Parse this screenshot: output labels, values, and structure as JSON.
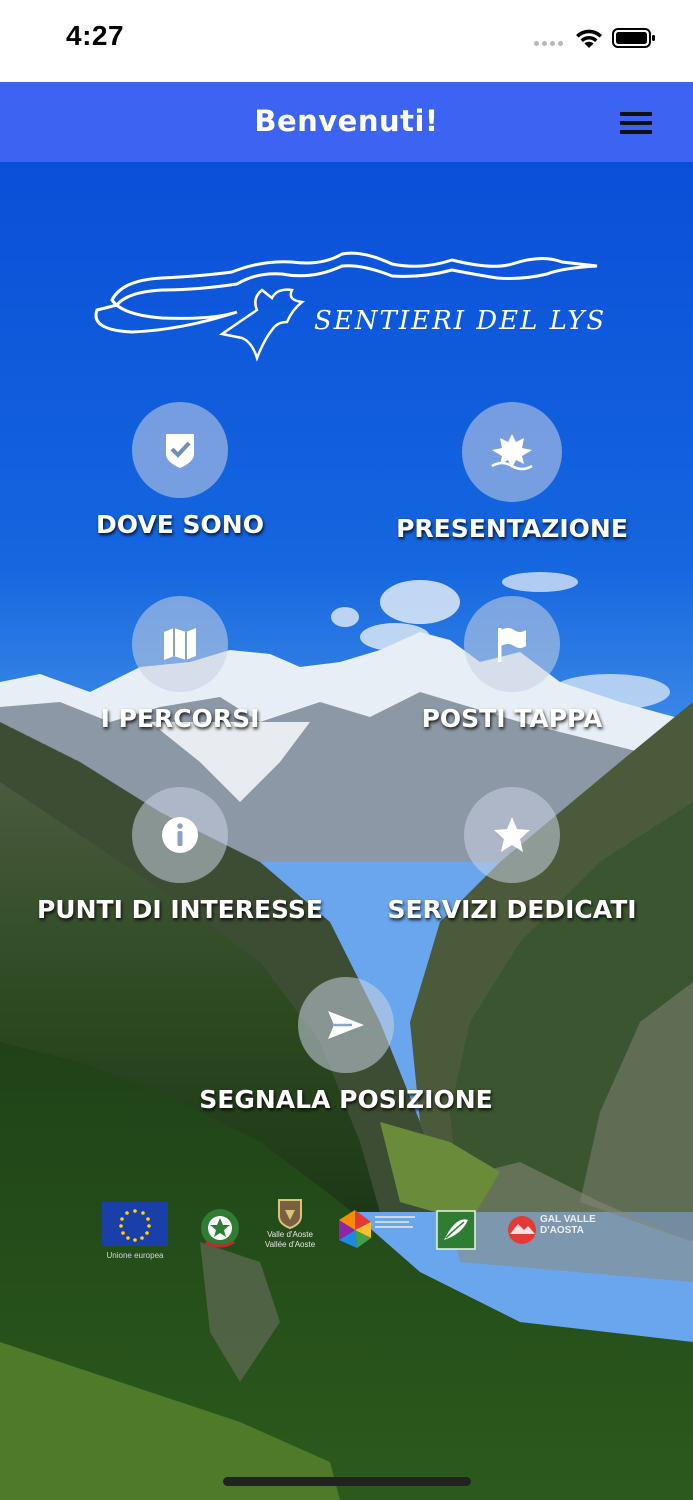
{
  "status_bar": {
    "time": "4:27",
    "icons": [
      "signal-icon",
      "wifi-icon",
      "battery-icon"
    ]
  },
  "header": {
    "title": "Benvenuti!",
    "menu_icon": "hamburger-menu-icon",
    "color": "#3d63f2"
  },
  "logo": {
    "text": "SENTIERI DEL LYS"
  },
  "menu": {
    "items": [
      {
        "label": "DOVE SONO",
        "icon": "check-shield-icon"
      },
      {
        "label": "PRESENTAZIONE",
        "icon": "leaf-icon"
      },
      {
        "label": "I PERCORSI",
        "icon": "map-icon"
      },
      {
        "label": "POSTI TAPPA",
        "icon": "flag-icon"
      },
      {
        "label": "PUNTI DI INTERESSE",
        "icon": "info-icon"
      },
      {
        "label": "SERVIZI DEDICATI",
        "icon": "star-icon"
      },
      {
        "label": "SEGNALA POSIZIONE",
        "icon": "send-icon"
      }
    ]
  },
  "sponsors": {
    "eu_caption": "Unione europea",
    "vda_caption_1": "Valle d'Aoste",
    "vda_caption_2": "Vallée d'Aoste",
    "gal_caption": "GAL VALLE D'AOSTA",
    "items": [
      "eu-flag-logo",
      "italian-republic-emblem-logo",
      "valle-daosta-logo",
      "feasr-logo",
      "leader-logo",
      "gal-valle-daosta-logo"
    ]
  }
}
